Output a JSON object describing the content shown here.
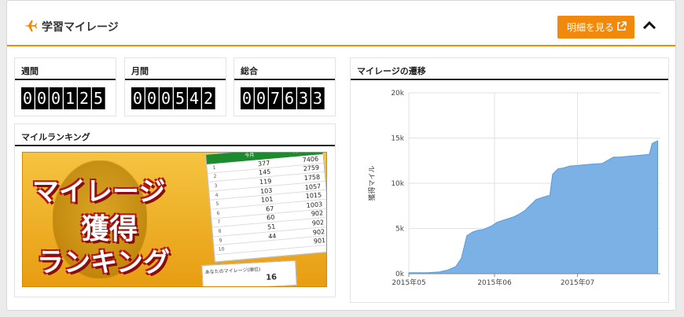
{
  "header": {
    "title": "学習マイレージ",
    "detail_button": "明細を見る"
  },
  "stats": {
    "weekly": {
      "label": "週間",
      "digits": [
        "0",
        "0",
        "0",
        "1",
        "2",
        "5"
      ]
    },
    "monthly": {
      "label": "月間",
      "digits": [
        "0",
        "0",
        "0",
        "5",
        "4",
        "2"
      ]
    },
    "total": {
      "label": "総合",
      "digits": [
        "0",
        "0",
        "7",
        "6",
        "3",
        "3"
      ]
    }
  },
  "ranking": {
    "title": "マイルランキング",
    "banner_lines": [
      "マイレージ",
      "獲得",
      "ランキング"
    ],
    "table_headers": [
      "今月",
      "先月"
    ],
    "this_month": [
      "377",
      "145",
      "119",
      "103",
      "101",
      "67",
      "60",
      "51",
      "44"
    ],
    "last_month": [
      "7406",
      "2759",
      "1758",
      "1057",
      "1015",
      "1003",
      "902",
      "902",
      "902",
      "901"
    ],
    "ranks": [
      "1",
      "2",
      "3",
      "4",
      "5",
      "6",
      "7",
      "8",
      "9",
      "10"
    ],
    "footer_label": "あなたのマイレージ(順位)",
    "footer_value": "16"
  },
  "chart": {
    "title": "マイレージの遷移",
    "ylabel": "獲得マイル"
  },
  "chart_data": {
    "type": "area",
    "title": "",
    "xlabel": "",
    "ylabel": "獲得マイル",
    "ylim": [
      0,
      20000
    ],
    "y_ticks": [
      "0k",
      "5k",
      "10k",
      "15k",
      "20k"
    ],
    "x_ticks": [
      {
        "label": "2015年05",
        "x": "2015-05-01"
      },
      {
        "label": "2015年06",
        "x": "2015-06-01"
      },
      {
        "label": "2015年07",
        "x": "2015-07-01"
      }
    ],
    "grid": true,
    "color": "#7cb1e6",
    "series": [
      {
        "x": [
          "2015-05-01",
          "2015-05-08",
          "2015-05-12",
          "2015-05-15",
          "2015-05-18",
          "2015-05-20",
          "2015-05-22",
          "2015-05-24",
          "2015-05-26",
          "2015-05-28",
          "2015-05-31",
          "2015-06-02",
          "2015-06-05",
          "2015-06-08",
          "2015-06-10",
          "2015-06-12",
          "2015-06-14",
          "2015-06-16",
          "2015-06-18",
          "2015-06-20",
          "2015-06-21",
          "2015-06-22",
          "2015-06-24",
          "2015-06-26",
          "2015-06-28",
          "2015-07-02",
          "2015-07-06",
          "2015-07-10",
          "2015-07-14",
          "2015-07-16",
          "2015-07-20",
          "2015-07-24",
          "2015-07-27",
          "2015-07-28",
          "2015-07-30"
        ],
        "values": [
          100,
          120,
          200,
          400,
          800,
          1700,
          4200,
          4600,
          4800,
          4900,
          5300,
          5700,
          6000,
          6300,
          6600,
          7000,
          7600,
          8200,
          8400,
          8600,
          8650,
          11000,
          11600,
          11700,
          11900,
          12000,
          12100,
          12200,
          12900,
          12900,
          13000,
          13100,
          13200,
          14400,
          14700
        ]
      }
    ]
  }
}
